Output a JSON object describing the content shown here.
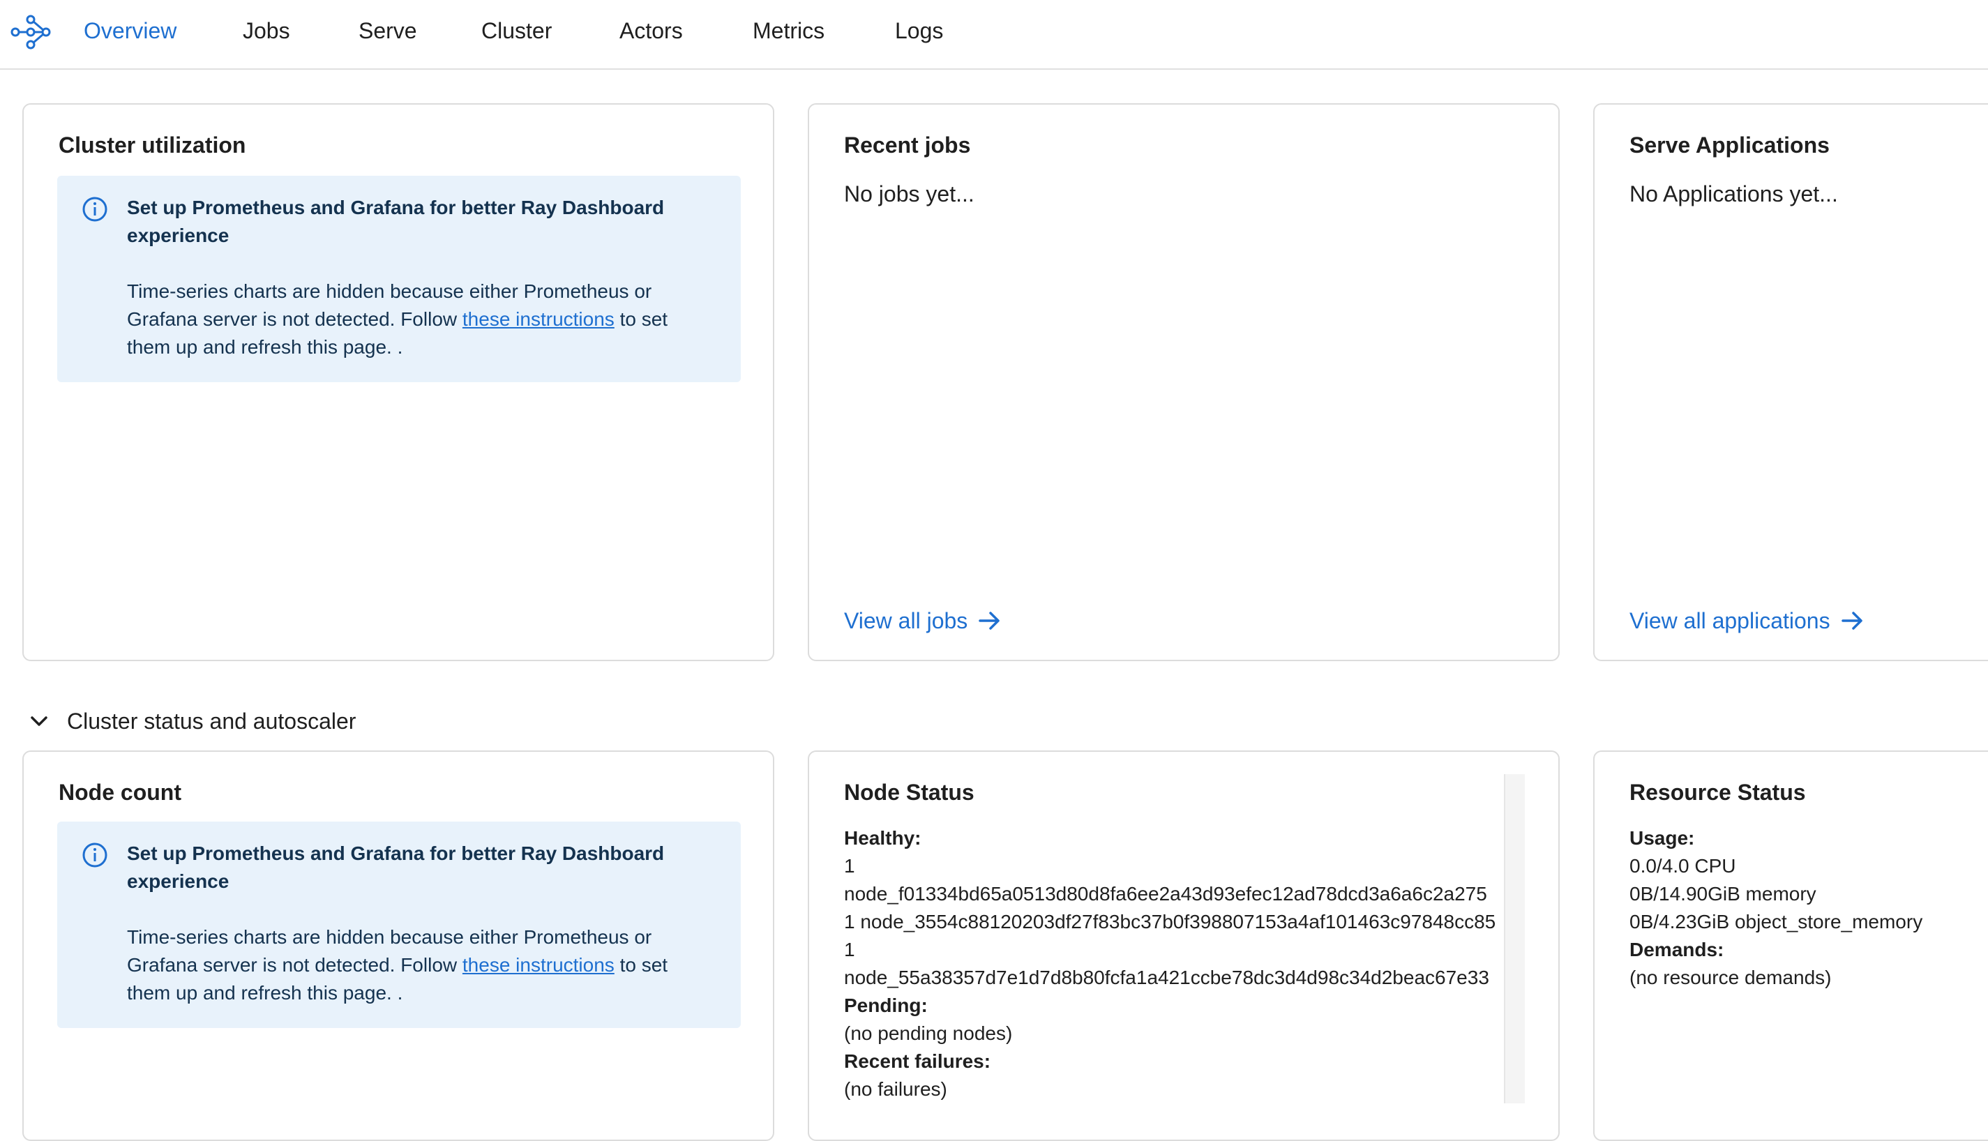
{
  "nav": {
    "logo_icon": "ray-logo-icon",
    "items": [
      "Overview",
      "Jobs",
      "Serve",
      "Cluster",
      "Actors",
      "Metrics",
      "Logs"
    ],
    "active": "Overview"
  },
  "colors": {
    "accent": "#1e6fd0",
    "alert_bg": "#e8f2fb",
    "alert_text": "#14324f"
  },
  "alert": {
    "title": "Set up Prometheus and Grafana for better Ray Dashboard experience",
    "body_before": "Time-series charts are hidden because either Prometheus or Grafana server is not detected. Follow ",
    "link": "these instructions",
    "body_after": " to set them up and refresh this page. ."
  },
  "cluster_utilization": {
    "title": "Cluster utilization"
  },
  "recent_jobs": {
    "title": "Recent jobs",
    "empty": "No jobs yet...",
    "link": "View all jobs"
  },
  "serve_apps": {
    "title": "Serve Applications",
    "empty": "No Applications yet...",
    "link": "View all applications"
  },
  "section": {
    "title": "Cluster status and autoscaler"
  },
  "node_count": {
    "title": "Node count"
  },
  "node_status": {
    "title": "Node Status",
    "healthy_label": "Healthy:",
    "healthy_lines": [
      "1",
      "node_f01334bd65a0513d80d8fa6ee2a43d93efec12ad78dcd3a6a6c2a275",
      "1 node_3554c88120203df27f83bc37b0f398807153a4af101463c97848cc85",
      "1",
      "node_55a38357d7e1d7d8b80fcfa1a421ccbe78dc3d4d98c34d2beac67e33"
    ],
    "pending_label": "Pending:",
    "pending": "(no pending nodes)",
    "failures_label": "Recent failures:",
    "failures": "(no failures)"
  },
  "resource_status": {
    "title": "Resource Status",
    "usage_label": "Usage:",
    "usage_lines": [
      "0.0/4.0 CPU",
      "0B/14.90GiB memory",
      "0B/4.23GiB object_store_memory"
    ],
    "demands_label": "Demands:",
    "demands": "(no resource demands)"
  }
}
